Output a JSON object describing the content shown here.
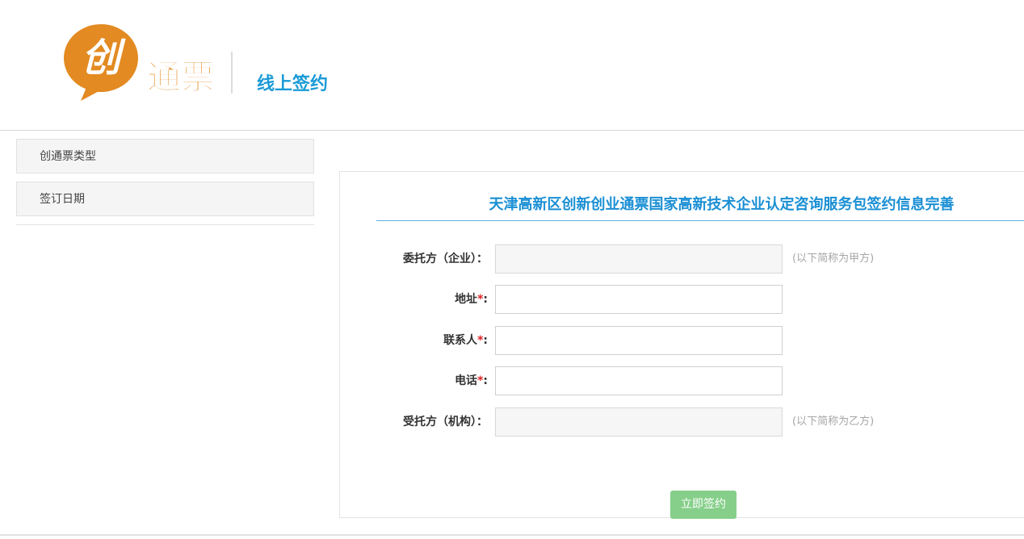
{
  "header": {
    "logo_text_1": "创",
    "logo_text_2": "通票",
    "subtitle": "线上签约"
  },
  "sidebar": {
    "items": [
      {
        "label": "创通票类型"
      },
      {
        "label": "签订日期"
      }
    ]
  },
  "form": {
    "title": "天津高新区创新创业通票国家高新技术企业认定咨询服务包签约信息完善",
    "fields": [
      {
        "label": "委托方（企业）：",
        "required": false,
        "value": "",
        "disabled": true,
        "hint": "(以下简称为甲方)"
      },
      {
        "label": "地址",
        "required": true,
        "value": "",
        "disabled": false,
        "hint": ""
      },
      {
        "label": "联系人",
        "required": true,
        "value": "",
        "disabled": false,
        "hint": ""
      },
      {
        "label": "电话",
        "required": true,
        "value": "",
        "disabled": false,
        "hint": ""
      },
      {
        "label": "受托方（机构）：",
        "required": false,
        "value": "",
        "disabled": true,
        "hint": "(以下简称为乙方)"
      }
    ],
    "required_mark": "*",
    "colon": ":",
    "submit_label": "立即签约"
  },
  "colors": {
    "brand_orange": "#e38a22",
    "accent_blue": "#1a9bd6",
    "submit_green": "#86cf8a",
    "required_red": "#e02020"
  }
}
